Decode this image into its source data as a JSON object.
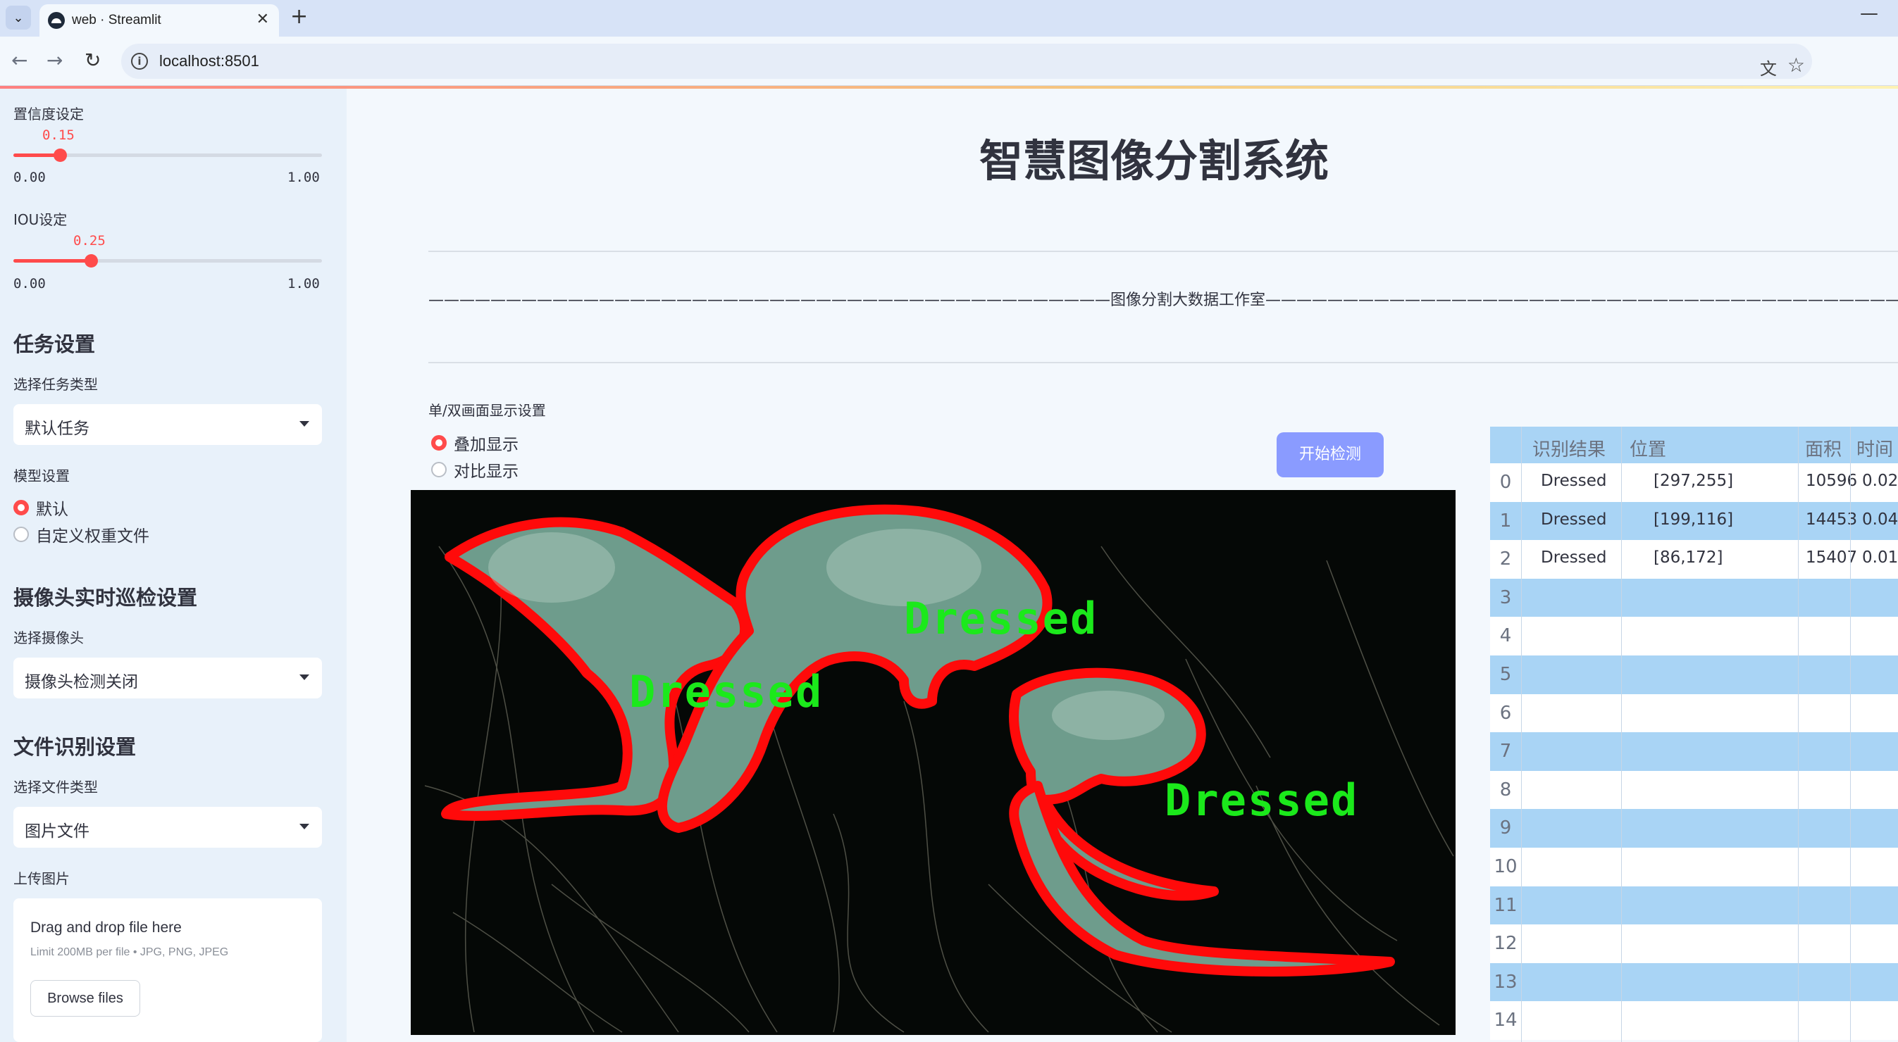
{
  "browser": {
    "tab_title": "web · Streamlit",
    "url": "localhost:8501"
  },
  "sidebar": {
    "confidence": {
      "label": "置信度设定",
      "value": "0.15",
      "min": "0.00",
      "max": "1.00",
      "fraction": 0.15
    },
    "iou": {
      "label": "IOU设定",
      "value": "0.25",
      "min": "0.00",
      "max": "1.00",
      "fraction": 0.25
    },
    "task": {
      "heading": "任务设置",
      "label": "选择任务类型",
      "selected": "默认任务"
    },
    "model": {
      "label": "模型设置",
      "options": [
        "默认",
        "自定义权重文件"
      ],
      "selected_index": 0
    },
    "camera": {
      "heading": "摄像头实时巡检设置",
      "label": "选择摄像头",
      "selected": "摄像头检测关闭"
    },
    "file": {
      "heading": "文件识别设置",
      "label": "选择文件类型",
      "selected": "图片文件"
    },
    "upload": {
      "label": "上传图片",
      "title": "Drag and drop file here",
      "subtitle": "Limit 200MB per file • JPG, PNG, JPEG",
      "button": "Browse files"
    }
  },
  "main": {
    "title": "智慧图像分割系统",
    "banner": "————————————————————————————————————————————图像分割大数据工作室————————————————————————————————————————————",
    "display_label": "单/双画面显示设置",
    "display_options": [
      "叠加显示",
      "对比显示"
    ],
    "display_selected_index": 0,
    "start_button": "开始检测",
    "detections": [
      {
        "label": "Dressed"
      },
      {
        "label": "Dressed"
      },
      {
        "label": "Dressed"
      }
    ]
  },
  "table": {
    "columns": [
      "识别结果",
      "位置",
      "面积",
      "时间"
    ],
    "rows": [
      {
        "index": "0",
        "result": "Dressed",
        "position": "[297,255]",
        "area": "10596",
        "time": "0.02"
      },
      {
        "index": "1",
        "result": "Dressed",
        "position": "[199,116]",
        "area": "14453",
        "time": "0.04"
      },
      {
        "index": "2",
        "result": "Dressed",
        "position": "[86,172]",
        "area": "15407",
        "time": "0.01"
      },
      {
        "index": "3"
      },
      {
        "index": "4"
      },
      {
        "index": "5"
      },
      {
        "index": "6"
      },
      {
        "index": "7"
      },
      {
        "index": "8"
      },
      {
        "index": "9"
      },
      {
        "index": "10"
      },
      {
        "index": "11"
      },
      {
        "index": "12"
      },
      {
        "index": "13"
      },
      {
        "index": "14"
      }
    ]
  },
  "colors": {
    "accent": "#ff4b4b",
    "button": "#8a9bff",
    "mask_outline": "#ff0a0a",
    "label_text": "#1be91b",
    "table_header": "#a9d4f5"
  }
}
